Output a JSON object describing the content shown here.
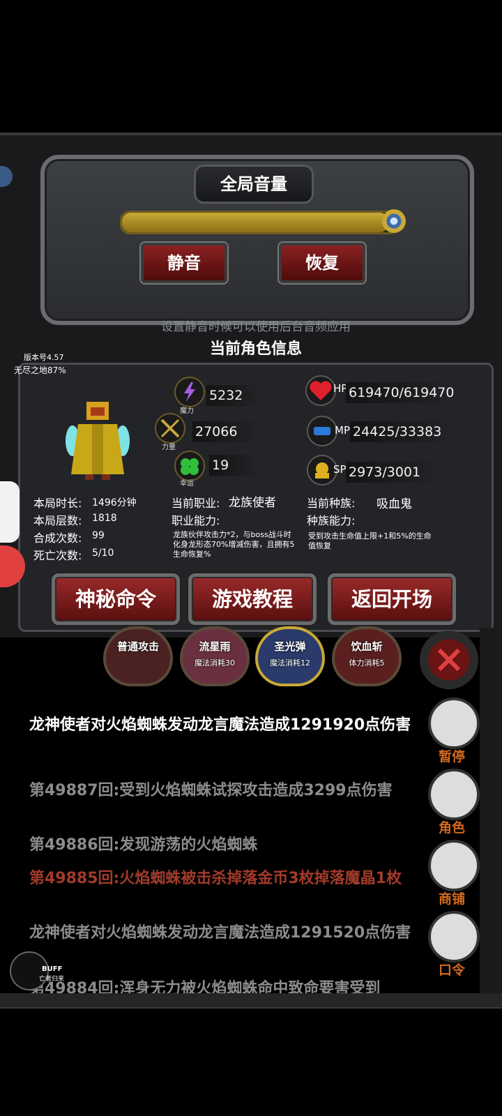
{
  "volume": {
    "title": "全局音量",
    "level": 0.97,
    "mute_label": "静音",
    "restore_label": "恢复",
    "hint": "设置静音时候可以使用后台音频应用"
  },
  "character": {
    "section_title": "当前角色信息",
    "version": "版本号4.57",
    "endless": "无尽之地87%",
    "magic_value": "5232",
    "magic_label": "魔力",
    "strength_value": "27066",
    "strength_label": "力量",
    "luck_value": "19",
    "luck_label": "幸运",
    "hp_label": "HP",
    "hp_value": "619470/619470",
    "mp_label": "MP",
    "mp_value": "24425/33383",
    "sp_label": "SP",
    "sp_value": "2973/3001",
    "stats": [
      {
        "label": "本局时长:",
        "value": "1496分钟"
      },
      {
        "label": "本局层数:",
        "value": "1818"
      },
      {
        "label": "合成次数:",
        "value": "99"
      },
      {
        "label": "死亡次数:",
        "value": "5/10"
      }
    ],
    "job_label": "当前职业:",
    "job_value": "龙族使者",
    "job_ability_label": "职业能力:",
    "job_ability_text": "龙族伙伴攻击力*2，与boss战斗时化身龙形态70%增减伤害，且拥有5生命恢复%",
    "race_label": "当前种族:",
    "race_value": "吸血鬼",
    "race_ability_label": "种族能力:",
    "race_ability_text": "受到攻击生命值上限+1和5%的生命值恢复"
  },
  "actions": {
    "secret_label": "神秘命令",
    "tutorial_label": "游戏教程",
    "back_label": "返回开场"
  },
  "skills": [
    {
      "name": "普通攻击",
      "cost": ""
    },
    {
      "name": "流星雨",
      "cost": "魔法消耗30"
    },
    {
      "name": "圣光弹",
      "cost": "魔法消耗12"
    },
    {
      "name": "饮血斩",
      "cost": "体力消耗5"
    }
  ],
  "log": [
    {
      "text": "龙神使者对火焰蜘蛛发动龙言魔法造成1291920点伤害",
      "color": "#ffffff"
    },
    {
      "text": "第49887回:受到火焰蜘蛛试探攻击造成3299点伤害",
      "color": "#8c8c8c"
    },
    {
      "text": "第49886回:发现游荡的火焰蜘蛛",
      "color": "#8c8c8c"
    },
    {
      "text": "第49885回:火焰蜘蛛被击杀掉落金币3枚掉落魔晶1枚",
      "color": "#a33a2a"
    },
    {
      "text": "龙神使者对火焰蜘蛛发动龙言魔法造成1291520点伤害",
      "color": "#8c8c8c"
    },
    {
      "text": "第49884回:浑身无力被火焰蜘蛛命中致命要害受到",
      "color": "#8c8c8c"
    }
  ],
  "side": {
    "pause_label": "暂停",
    "role_label": "角色",
    "shop_label": "商铺",
    "code_label": "口令"
  },
  "buff": {
    "label": "BUFF",
    "sub": "亡者归来"
  },
  "colors": {
    "accent_red": "#8a2020",
    "gold": "#c9a936",
    "log_red": "#a33a2a"
  }
}
